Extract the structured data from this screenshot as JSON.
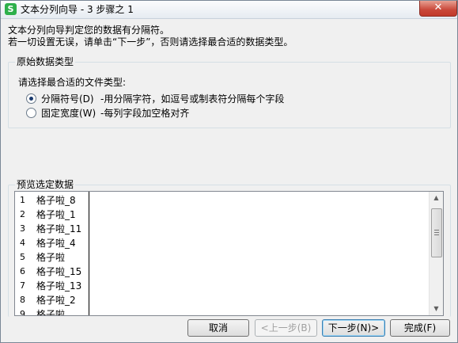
{
  "window": {
    "title": "文本分列向导 - 3 步骤之 1",
    "app_icon_letter": "S",
    "close_symbol": "✕"
  },
  "intro": {
    "line1": "文本分列向导判定您的数据有分隔符。",
    "line2": "若一切设置无误，请单击“下一步”，否则请选择最合适的数据类型。"
  },
  "original_data_type": {
    "group_label": "原始数据类型",
    "prompt": "请选择最合适的文件类型:",
    "options": [
      {
        "label": "分隔符号(D)",
        "description": "-用分隔字符，如逗号或制表符分隔每个字段",
        "checked": true
      },
      {
        "label": "固定宽度(W)",
        "description": "-每列字段加空格对齐",
        "checked": false
      }
    ]
  },
  "preview": {
    "group_label": "预览选定数据",
    "rows": [
      {
        "num": "1",
        "value": "格子啦_8"
      },
      {
        "num": "2",
        "value": "格子啦_1"
      },
      {
        "num": "3",
        "value": "格子啦_11"
      },
      {
        "num": "4",
        "value": "格子啦_4"
      },
      {
        "num": "5",
        "value": "格子啦"
      },
      {
        "num": "6",
        "value": "格子啦_15"
      },
      {
        "num": "7",
        "value": "格子啦_13"
      },
      {
        "num": "8",
        "value": "格子啦_2"
      },
      {
        "num": "9",
        "value": "格子啦"
      }
    ],
    "scroll_up_symbol": "▲",
    "scroll_down_symbol": "▼"
  },
  "buttons": {
    "cancel": "取消",
    "back": "<上一步(B)",
    "next": "下一步(N)>",
    "finish": "完成(F)"
  }
}
